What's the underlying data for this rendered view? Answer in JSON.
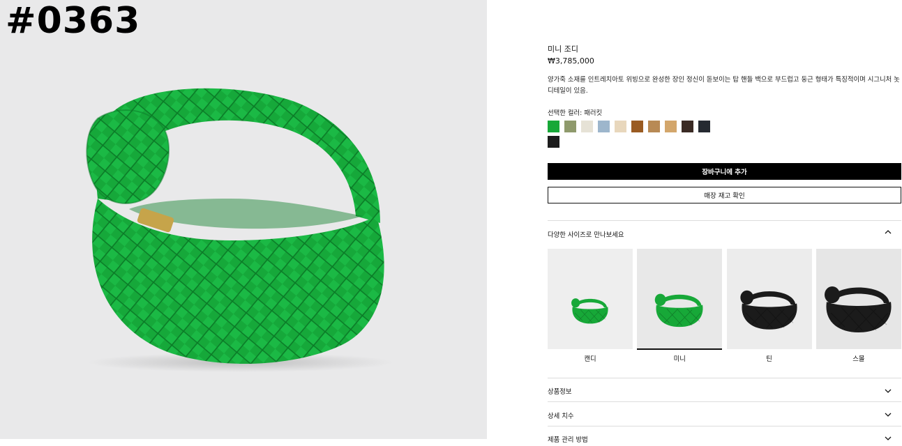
{
  "watermark": "#0363",
  "product": {
    "title": "미니 조디",
    "price": "₩3,785,000",
    "description": "양가죽 소재를 인트레치아토 위빙으로 완성한 장인 정신이 돋보이는 탑 핸들 백으로 부드럽고 둥근 형태가 특징적이며 시그니처 놋 디테일이 있음.",
    "selected_color_label": "선택한 컬러: 패러킷",
    "bag_color": "#16a83a"
  },
  "swatches": [
    {
      "name": "parakeet",
      "color": "#17a838",
      "selected": true
    },
    {
      "name": "olive",
      "color": "#8f9a6c"
    },
    {
      "name": "ivory",
      "color": "#e6e2d6"
    },
    {
      "name": "light-blue",
      "color": "#9db6cc"
    },
    {
      "name": "cream",
      "color": "#e8d7bc"
    },
    {
      "name": "brown",
      "color": "#9a5b22"
    },
    {
      "name": "tan",
      "color": "#b88a55"
    },
    {
      "name": "camel",
      "color": "#d3a66b"
    },
    {
      "name": "dark-brown",
      "color": "#3a2a24"
    },
    {
      "name": "navy-black",
      "color": "#262a31"
    },
    {
      "name": "black",
      "color": "#1c1c1c"
    }
  ],
  "buttons": {
    "add_to_cart": "장바구니에 추가",
    "check_stock": "매장 재고 확인"
  },
  "sizes_section": {
    "label": "다양한 사이즈로 만나보세요",
    "items": [
      {
        "label": "캔디",
        "bag_color": "#17a838",
        "scale": "candy"
      },
      {
        "label": "미니",
        "bag_color": "#17a838",
        "scale": "mini",
        "selected": true
      },
      {
        "label": "틴",
        "bag_color": "#1b1b1b",
        "scale": "teen"
      },
      {
        "label": "스몰",
        "bag_color": "#1b1b1b",
        "scale": "small"
      }
    ]
  },
  "accordions": [
    {
      "label": "상품정보"
    },
    {
      "label": "상세 치수"
    },
    {
      "label": "제품 관리 방법"
    }
  ]
}
